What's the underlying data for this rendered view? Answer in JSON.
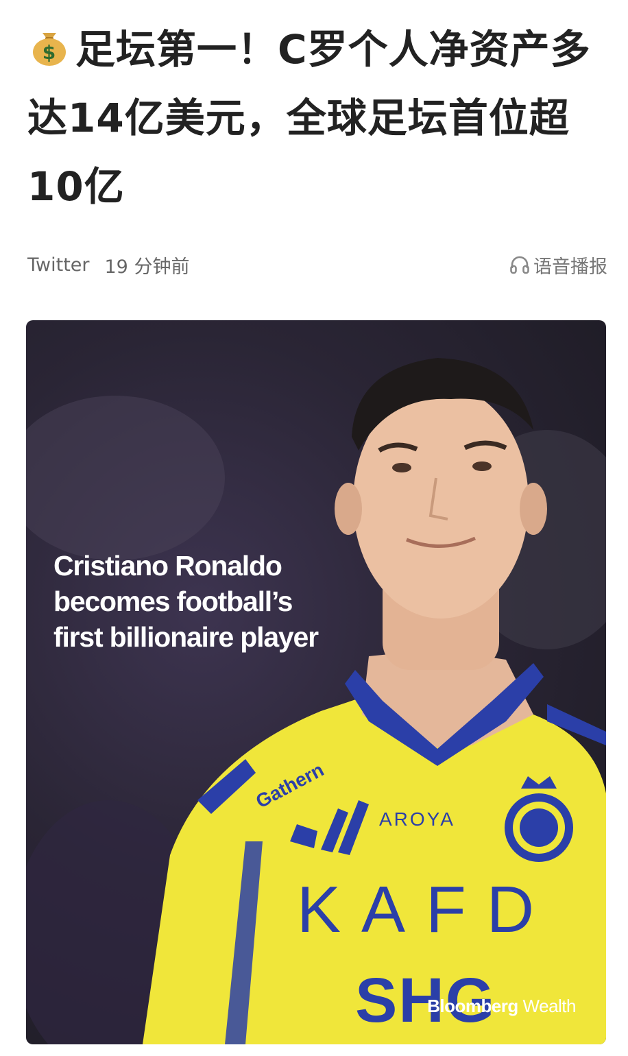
{
  "article": {
    "headline": "足坛第一！C罗个人净资产多达14亿美元，全球足坛首位超10亿",
    "headline_icon": "money-bag-icon",
    "source": "Twitter",
    "time": "19 分钟前",
    "listen_label": "语音播报",
    "listen_icon": "headphones-icon"
  },
  "image": {
    "overlay_title": "Cristiano Ronaldo\nbecomes football’s\nfirst billionaire player",
    "watermark_brand": "Bloomberg",
    "watermark_suffix": " Wealth",
    "jersey": {
      "sponsor_main": "KAFD",
      "sponsor_bottom": "SHG",
      "sponsor_chest": "AROYA",
      "sponsor_sleeve": "Gathern"
    },
    "colors": {
      "jersey_yellow": "#f2ea3a",
      "jersey_blue": "#2b3fa8",
      "background": "#2a2535"
    }
  }
}
